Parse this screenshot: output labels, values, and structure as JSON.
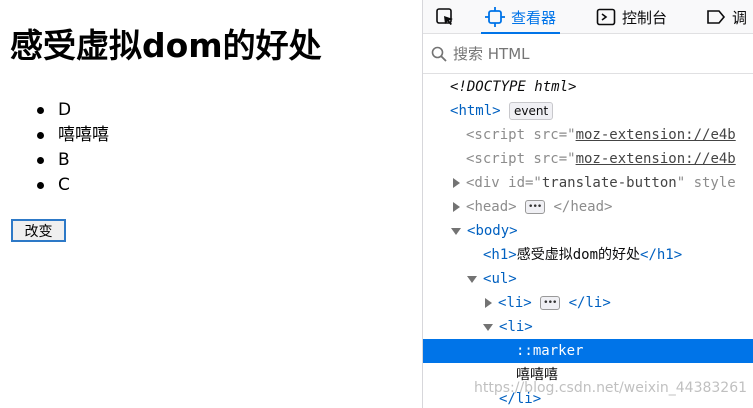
{
  "page": {
    "heading": "感受虚拟dom的好处",
    "list_items": [
      "D",
      "嘻嘻嘻",
      "B",
      "C"
    ],
    "change_button": "改变"
  },
  "devtools": {
    "tabs": {
      "inspector": "查看器",
      "console": "控制台",
      "debugger": "调"
    },
    "search_placeholder": "搜索 HTML",
    "tree": {
      "doctype": "<!DOCTYPE html>",
      "html_tag": "html",
      "event_badge": "event",
      "script_src": "moz-extension://e4b",
      "div_id": "translate-button",
      "div_style_attr": "style",
      "head_tag": "head",
      "body_tag": "body",
      "h1_text": "感受虚拟dom的好处",
      "ul_tag": "ul",
      "li_tag": "li",
      "marker": "::marker",
      "text_node": "嘻嘻嘻"
    }
  },
  "watermark": "https://blog.csdn.net/weixin_44383261",
  "colors": {
    "accent": "#0074e8",
    "tag": "#0060c0",
    "selected_bg": "#0074e8"
  }
}
